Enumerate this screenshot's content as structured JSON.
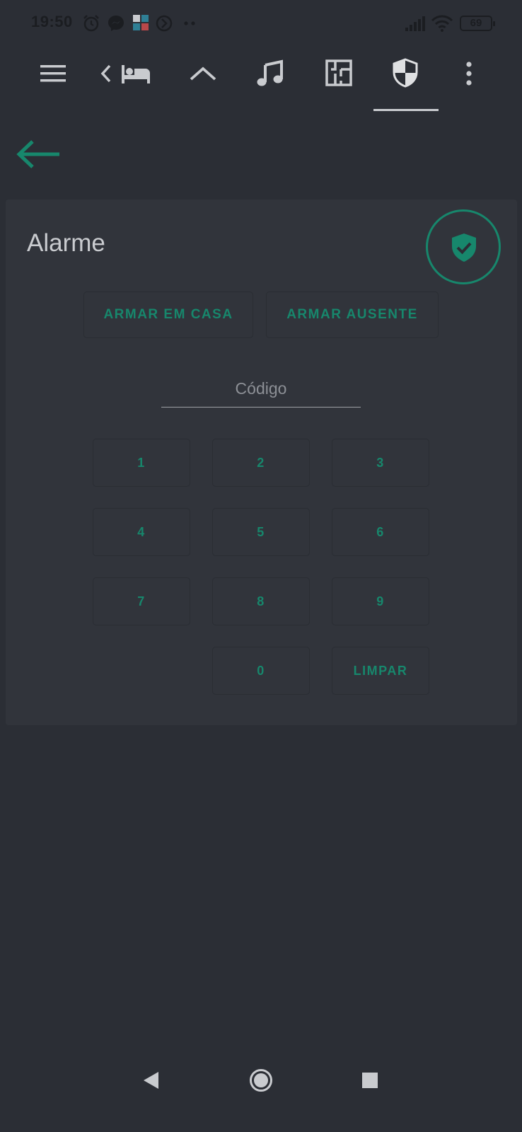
{
  "status_bar": {
    "time": "19:50",
    "battery": "69",
    "icons": [
      "alarm-clock-icon",
      "messenger-icon",
      "app-notification-icon",
      "sync-icon",
      "more-dots-icon",
      "signal-icon",
      "wifi-icon",
      "battery-icon"
    ]
  },
  "toolbar": {
    "icons": [
      "menu-icon",
      "chevron-left-icon",
      "bed-icon",
      "home-roof-icon",
      "music-note-icon",
      "floorplan-icon",
      "shield-icon",
      "overflow-menu-icon"
    ],
    "active_tab": "shield-icon"
  },
  "alarm": {
    "title": "Alarme",
    "state_icon": "shield-check-icon",
    "arm_home_label": "ARMAR EM CASA",
    "arm_away_label": "ARMAR AUSENTE",
    "code_placeholder": "Código",
    "keys": {
      "k1": "1",
      "k2": "2",
      "k3": "3",
      "k4": "4",
      "k5": "5",
      "k6": "6",
      "k7": "7",
      "k8": "8",
      "k9": "9",
      "k0": "0",
      "clear": "LIMPAR"
    }
  },
  "colors": {
    "background": "#2b2e35",
    "card": "#31343b",
    "accent": "#17876c",
    "text": "#c9cbcf"
  },
  "navigation_bar": {
    "icons": [
      "back-triangle-icon",
      "home-circle-icon",
      "recents-square-icon"
    ]
  }
}
